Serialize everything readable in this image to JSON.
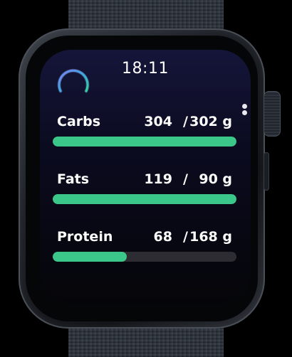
{
  "status": {
    "time": "18:11"
  },
  "icons": {
    "ring": "progress-ring-icon",
    "scroll": "page-indicator-dots"
  },
  "colors": {
    "bar_fill": "#3cc78a",
    "bar_track": "#2c2c32",
    "ring_gradient": [
      "#7d7ff2",
      "#3aa9e0",
      "#2fd39a"
    ]
  },
  "macros": [
    {
      "name": "Carbs",
      "current": "304",
      "separator": "/",
      "goal": "302 g",
      "progress": 1.0
    },
    {
      "name": "Fats",
      "current": "119",
      "separator": "/",
      "goal": "90 g",
      "progress": 1.0
    },
    {
      "name": "Protein",
      "current": "68",
      "separator": "/",
      "goal": "168 g",
      "progress": 0.405
    }
  ]
}
